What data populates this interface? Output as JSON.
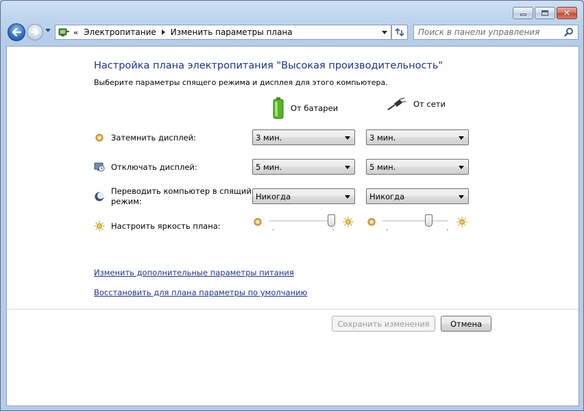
{
  "address": {
    "crumbs": [
      "Электропитание",
      "Изменить параметры плана"
    ],
    "chevron": "«"
  },
  "search": {
    "placeholder": "Поиск в панели управления"
  },
  "page": {
    "title": "Настройка плана электропитания \"Высокая производительность\"",
    "subtitle": "Выберите параметры спящего режима и дисплея для этого компьютера."
  },
  "columns": {
    "battery": "От батареи",
    "ac": "От сети"
  },
  "settings": {
    "dim": {
      "label": "Затемнить дисплей:",
      "battery": "3 мин.",
      "ac": "3 мин."
    },
    "off": {
      "label": "Отключать дисплей:",
      "battery": "5 мин.",
      "ac": "5 мин."
    },
    "sleep": {
      "label_line1": "Переводить компьютер в спящий",
      "label_line2": "режим:",
      "battery": "Никогда",
      "ac": "Никогда"
    },
    "brightness": {
      "label": "Настроить яркость плана:",
      "battery_level": 0.95,
      "ac_level": 0.7
    }
  },
  "links": {
    "advanced": "Изменить дополнительные параметры питания",
    "restore": "Восстановить для плана параметры по умолчанию"
  },
  "buttons": {
    "save": "Сохранить изменения",
    "cancel": "Отмена"
  },
  "icons": {
    "back": "back-arrow-icon",
    "forward": "forward-arrow-icon",
    "refresh": "refresh-icon",
    "search": "search-icon",
    "battery": "battery-icon",
    "plug": "plug-icon",
    "dim": "dim-display-icon",
    "off": "display-off-clock-icon",
    "sleep": "sleep-moon-icon",
    "brightness": "sun-icon"
  },
  "colors": {
    "link": "#1e3287",
    "title": "#1e3287",
    "chrome": "#bcd3ec"
  }
}
